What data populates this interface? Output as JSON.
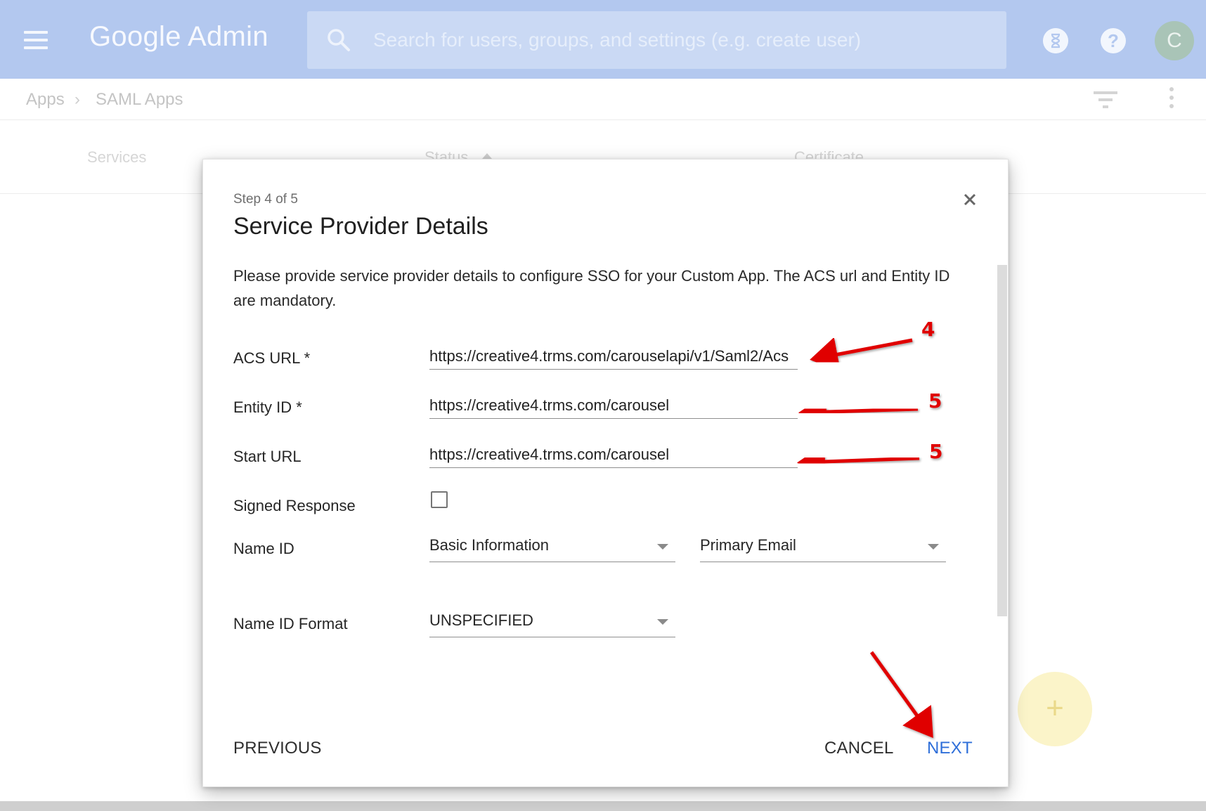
{
  "header": {
    "brand": "Google Admin",
    "search_placeholder": "Search for users, groups, and settings (e.g. create user)",
    "avatar_letter": "C",
    "help_glyph": "?"
  },
  "breadcrumb": {
    "items": [
      "Apps",
      "SAML Apps"
    ],
    "separator": "›"
  },
  "table": {
    "columns": [
      "Services",
      "Status",
      "Certificate"
    ]
  },
  "fab": {
    "glyph": "+"
  },
  "modal": {
    "step": "Step 4 of 5",
    "title": "Service Provider Details",
    "description": "Please provide service provider details to configure SSO for your Custom App. The ACS url and Entity ID are mandatory.",
    "fields": {
      "acs_label": "ACS URL *",
      "acs_value": "https://creative4.trms.com/carouselapi/v1/Saml2/Acs",
      "entity_label": "Entity ID *",
      "entity_value": "https://creative4.trms.com/carousel",
      "start_label": "Start URL",
      "start_value": "https://creative4.trms.com/carousel",
      "signed_label": "Signed Response",
      "signed_checked": false,
      "nameid_label": "Name ID",
      "nameid_category": "Basic Information",
      "nameid_value": "Primary Email",
      "nameid_format_label": "Name ID Format",
      "nameid_format_value": "UNSPECIFIED"
    },
    "buttons": {
      "previous": "PREVIOUS",
      "cancel": "CANCEL",
      "next": "NEXT"
    }
  },
  "annotations": [
    {
      "label": "4",
      "target": "acs-url-field"
    },
    {
      "label": "5",
      "target": "entity-id-field"
    },
    {
      "label": "5",
      "target": "start-url-field"
    }
  ],
  "colors": {
    "topbar": "#b3c8ef",
    "accent": "#2f6fd9",
    "annotation": "#e00000",
    "fab": "#fbf4c9"
  },
  "icons": [
    "menu-icon",
    "search-icon",
    "hourglass-icon",
    "help-icon",
    "filter-icon",
    "more-vert-icon",
    "close-icon",
    "chevron-down-icon",
    "sort-up-icon",
    "add-icon"
  ]
}
